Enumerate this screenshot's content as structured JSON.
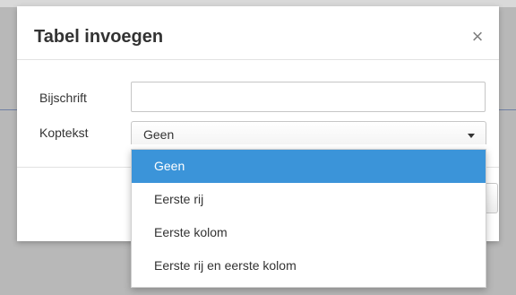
{
  "dialog": {
    "title": "Tabel invoegen",
    "close_glyph": "×",
    "close_icon": "close-icon"
  },
  "form": {
    "caption_label": "Bijschrift",
    "caption_value": "",
    "header_label": "Koptekst",
    "header_value": "Geen",
    "header_options": [
      {
        "label": "Geen",
        "selected": true
      },
      {
        "label": "Eerste rij",
        "selected": false
      },
      {
        "label": "Eerste kolom",
        "selected": false
      },
      {
        "label": "Eerste rij en eerste kolom",
        "selected": false
      }
    ]
  },
  "colors": {
    "selected_option": "#3b94d9",
    "overlay": "#b8b8b8"
  }
}
